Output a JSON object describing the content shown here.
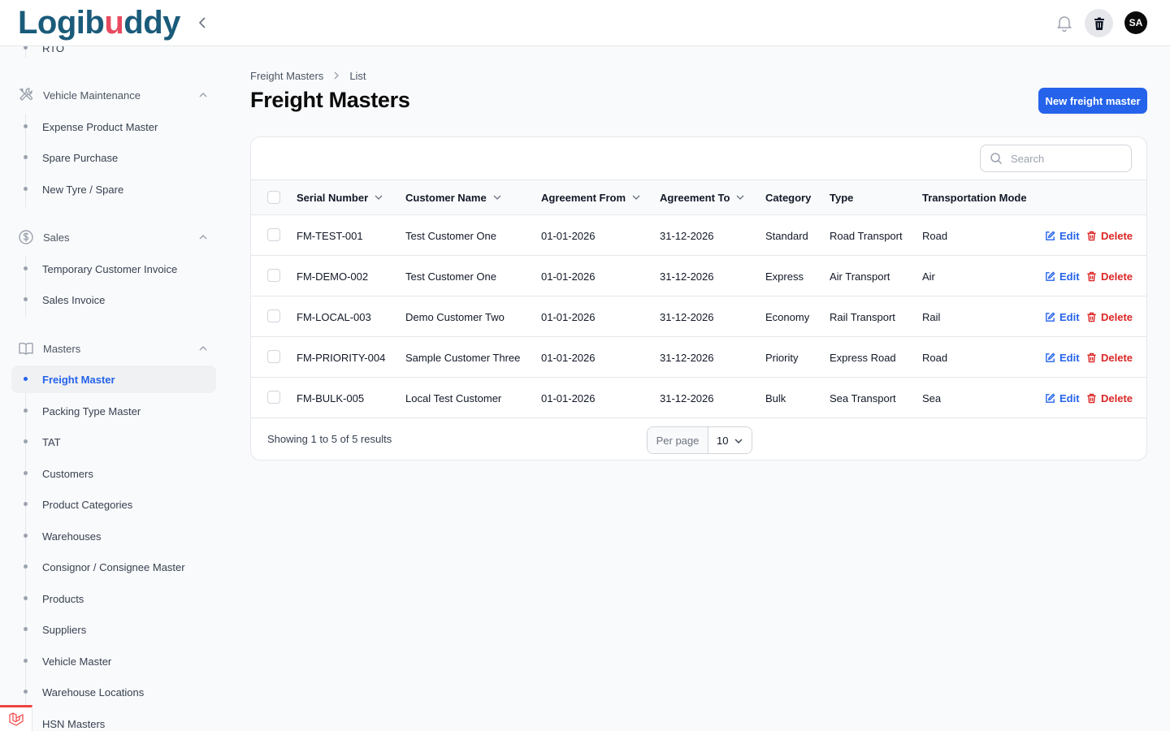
{
  "brand": {
    "logo_text_a": "Logib",
    "logo_text_dot": "u",
    "logo_text_b": "ddy"
  },
  "header": {
    "avatar_initials": "SA"
  },
  "sidebar": {
    "partial_item": "RTO",
    "groups": [
      {
        "label": "Vehicle Maintenance",
        "items": [
          "Expense Product Master",
          "Spare Purchase",
          "New Tyre / Spare"
        ]
      },
      {
        "label": "Sales",
        "items": [
          "Temporary Customer Invoice",
          "Sales Invoice"
        ]
      },
      {
        "label": "Masters",
        "items": [
          "Freight Master",
          "Packing Type Master",
          "TAT",
          "Customers",
          "Product Categories",
          "Warehouses",
          "Consignor / Consignee Master",
          "Products",
          "Suppliers",
          "Vehicle Master",
          "Warehouse Locations",
          "HSN Masters"
        ]
      }
    ],
    "active_item": "Freight Master"
  },
  "breadcrumb": {
    "parent": "Freight Masters",
    "current": "List"
  },
  "page": {
    "title": "Freight Masters",
    "new_button": "New freight master"
  },
  "search": {
    "placeholder": "Search"
  },
  "table": {
    "columns": [
      "Serial Number",
      "Customer Name",
      "Agreement From",
      "Agreement To",
      "Category",
      "Type",
      "Transportation Mode"
    ],
    "rows": [
      [
        "FM-TEST-001",
        "Test Customer One",
        "01-01-2026",
        "31-12-2026",
        "Standard",
        "Road Transport",
        "Road"
      ],
      [
        "FM-DEMO-002",
        "Test Customer One",
        "01-01-2026",
        "31-12-2026",
        "Express",
        "Air Transport",
        "Air"
      ],
      [
        "FM-LOCAL-003",
        "Demo Customer Two",
        "01-01-2026",
        "31-12-2026",
        "Economy",
        "Rail Transport",
        "Rail"
      ],
      [
        "FM-PRIORITY-004",
        "Sample Customer Three",
        "01-01-2026",
        "31-12-2026",
        "Priority",
        "Express Road",
        "Road"
      ],
      [
        "FM-BULK-005",
        "Local Test Customer",
        "01-01-2026",
        "31-12-2026",
        "Bulk",
        "Sea Transport",
        "Sea"
      ]
    ],
    "edit_label": "Edit",
    "delete_label": "Delete"
  },
  "footer": {
    "results_text": "Showing 1 to 5 of 5 results",
    "per_page_label": "Per page",
    "per_page_value": "10"
  },
  "colors": {
    "primary": "#2563eb",
    "danger": "#dc2626",
    "logo": "#1a5b7a",
    "logo_dot": "#e84a5f"
  }
}
